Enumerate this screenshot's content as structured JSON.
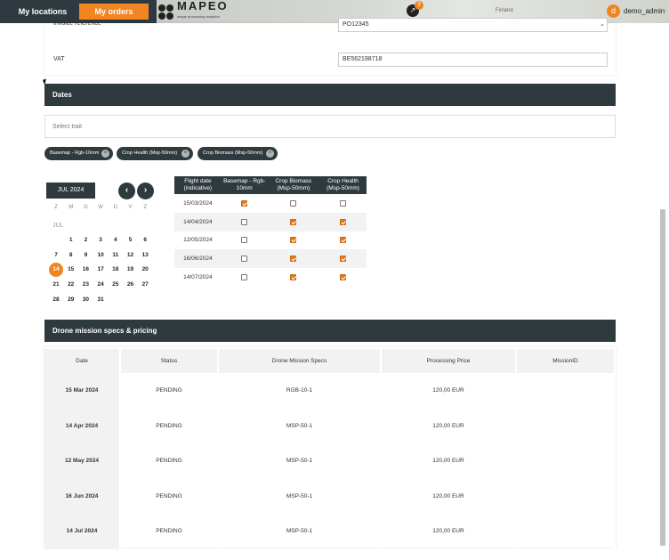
{
  "nav": {
    "my_locations": "My locations",
    "my_orders": "My orders",
    "notifications_count": "7",
    "user_initial": "d",
    "username": "demo_admin"
  },
  "brand": {
    "name": "MAPEO",
    "tagline": "image processing analytics"
  },
  "map": {
    "label_finland": "Finland"
  },
  "invoice": {
    "reference_label": "Invoice reference",
    "reference_value": "PO12345",
    "vat_label": "VAT",
    "vat_value": "BE562198718"
  },
  "dates": {
    "title": "Dates",
    "trait_placeholder": "Select trait",
    "chips": [
      "Basemap - Rgb-10mm",
      "Crop Health (Msp-50mm)",
      "Crop Biomass (Msp-50mm)"
    ],
    "calendar": {
      "month": "JUL 2024",
      "weekdays": [
        "Z",
        "M",
        "D",
        "W",
        "D",
        "V",
        "Z"
      ],
      "month_short": "JUL",
      "selected_day": "14",
      "days": [
        "1",
        "2",
        "3",
        "4",
        "5",
        "6",
        "7",
        "8",
        "9",
        "10",
        "11",
        "12",
        "13",
        "14",
        "15",
        "16",
        "17",
        "18",
        "19",
        "20",
        "21",
        "22",
        "23",
        "24",
        "25",
        "26",
        "27",
        "28",
        "29",
        "30",
        "31"
      ]
    },
    "table": {
      "headers": [
        "Flight date (indicative)",
        "Basemap - Rgb-10mm",
        "Crop Biomass (Msp-50mm)",
        "Crop Health (Msp-50mm)"
      ],
      "rows": [
        {
          "date": "15/03/2024",
          "basemap": true,
          "biomass": false,
          "health": false
        },
        {
          "date": "14/04/2024",
          "basemap": false,
          "biomass": true,
          "health": true
        },
        {
          "date": "12/05/2024",
          "basemap": false,
          "biomass": true,
          "health": true
        },
        {
          "date": "16/06/2024",
          "basemap": false,
          "biomass": true,
          "health": true
        },
        {
          "date": "14/07/2024",
          "basemap": false,
          "biomass": true,
          "health": true
        }
      ]
    }
  },
  "pricing": {
    "title": "Drone mission specs & pricing",
    "headers": [
      "Date",
      "Status",
      "Drone Mission Specs",
      "Processing Price",
      "MissionID"
    ],
    "rows": [
      {
        "date": "15 Mar 2024",
        "status": "PENDING",
        "specs": "RGB-10-1",
        "price": "120,00 EUR",
        "mission_id": ""
      },
      {
        "date": "14 Apr 2024",
        "status": "PENDING",
        "specs": "MSP-50-1",
        "price": "120,00 EUR",
        "mission_id": ""
      },
      {
        "date": "12 May 2024",
        "status": "PENDING",
        "specs": "MSP-50-1",
        "price": "120,00 EUR",
        "mission_id": ""
      },
      {
        "date": "16 Jun 2024",
        "status": "PENDING",
        "specs": "MSP-50-1",
        "price": "120,00 EUR",
        "mission_id": ""
      },
      {
        "date": "14 Jul 2024",
        "status": "PENDING",
        "specs": "MSP-50-1",
        "price": "120,00 EUR",
        "mission_id": ""
      }
    ]
  },
  "colors": {
    "accent": "#f08522",
    "dark": "#2f3a3e"
  }
}
